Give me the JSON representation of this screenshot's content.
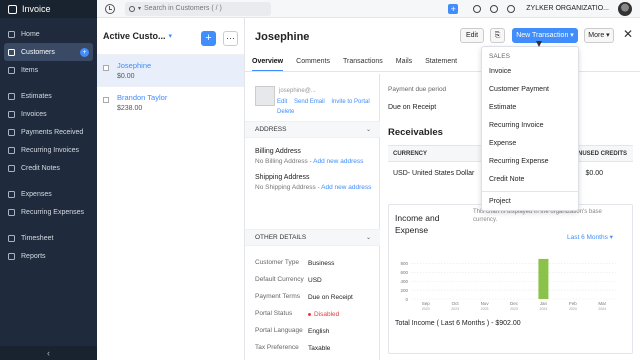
{
  "app": {
    "name": "Invoice"
  },
  "sidebar": {
    "items": [
      {
        "label": "Home",
        "icon": "home-icon"
      },
      {
        "label": "Customers",
        "icon": "users-icon",
        "active": true,
        "badge": "+"
      },
      {
        "label": "Items",
        "icon": "box-icon"
      },
      {
        "label": "Estimates",
        "icon": "estimate-icon"
      },
      {
        "label": "Invoices",
        "icon": "invoice-icon"
      },
      {
        "label": "Payments Received",
        "icon": "payments-icon"
      },
      {
        "label": "Recurring Invoices",
        "icon": "recurring-icon"
      },
      {
        "label": "Credit Notes",
        "icon": "credit-note-icon"
      },
      {
        "label": "Expenses",
        "icon": "expense-icon"
      },
      {
        "label": "Recurring Expenses",
        "icon": "recurring-expense-icon"
      },
      {
        "label": "Timesheet",
        "icon": "timesheet-icon"
      },
      {
        "label": "Reports",
        "icon": "reports-icon"
      }
    ],
    "collapse_label": "‹"
  },
  "topbar": {
    "search_placeholder": "Search in Customers ( / )",
    "org_name": "ZYLKER ORGANIZATIO...",
    "quick_add": "+",
    "icons": [
      "history-icon",
      "search-icon",
      "quick-add-icon",
      "notification-icon",
      "settings-icon",
      "apps-icon"
    ]
  },
  "list": {
    "title": "Active Custo...",
    "new_label": "+",
    "more_label": "···",
    "customers": [
      {
        "name": "Josephine",
        "amount": "$0.00",
        "selected": true
      },
      {
        "name": "Brandon Taylor",
        "amount": "$238.00",
        "selected": false
      }
    ]
  },
  "detail": {
    "title": "Josephine",
    "buttons": {
      "edit": "Edit",
      "attach": "⎘",
      "new_transaction": "New Transaction ▾",
      "more": "More ▾",
      "close": "✕"
    },
    "tabs": [
      "Overview",
      "Comments",
      "Transactions",
      "Mails",
      "Statement"
    ],
    "contact": {
      "email": "josephine@...",
      "links": [
        "Edit",
        "Send Email",
        "Invite to Portal"
      ],
      "delete": "Delete"
    },
    "address": {
      "header": "ADDRESS",
      "billing_label": "Billing Address",
      "billing_value": "No Billing Address",
      "billing_link": "Add new address",
      "shipping_label": "Shipping Address",
      "shipping_value": "No Shipping Address",
      "shipping_link": "Add new address"
    },
    "other_details": {
      "header": "OTHER DETAILS",
      "rows": [
        {
          "key": "Customer Type",
          "value": "Business"
        },
        {
          "key": "Default Currency",
          "value": "USD"
        },
        {
          "key": "Payment Terms",
          "value": "Due on Receipt"
        },
        {
          "key": "Portal Status",
          "value": "Disabled"
        },
        {
          "key": "Portal Language",
          "value": "English"
        },
        {
          "key": "Tax Preference",
          "value": "Taxable"
        }
      ]
    },
    "payment": {
      "label": "Payment due period",
      "value": "Due on Receipt"
    },
    "receivables": {
      "title": "Receivables",
      "columns": [
        "CURRENCY",
        "UNUSED CREDITS"
      ],
      "row": {
        "currency": "USD- United States Dollar",
        "unused_credits": "$0.00"
      }
    },
    "income": {
      "title": "Income and Expense",
      "note": "This chart is displayed in the organization's base currency.",
      "period": "Last 6 Months ▾",
      "total_label": "Total Income ( Last 6 Months ) - $902.00"
    }
  },
  "chart_data": {
    "type": "bar",
    "categories": [
      "Sep",
      "Oct",
      "Nov",
      "Dec",
      "Jan",
      "Feb",
      "Mar"
    ],
    "sub_labels": [
      "2023",
      "2023",
      "2023",
      "2023",
      "2024",
      "2024",
      "2024"
    ],
    "series": [
      {
        "values": [
          0,
          0,
          0,
          0,
          902,
          0,
          0
        ],
        "color": "#8bc34a"
      }
    ],
    "y_ticks": [
      0,
      200,
      400,
      600,
      800
    ],
    "ylim": [
      0,
      900
    ],
    "grid": true
  },
  "dropdown": {
    "header": "SALES",
    "items": [
      "Invoice",
      "Customer Payment",
      "Estimate",
      "Recurring Invoice",
      "Expense",
      "Recurring Expense",
      "Credit Note"
    ],
    "footer_item": "Project"
  },
  "colors": {
    "accent": "#408dfb",
    "sidebar": "#1f2b3d",
    "bar": "#8bc34a",
    "danger": "#e04040"
  }
}
